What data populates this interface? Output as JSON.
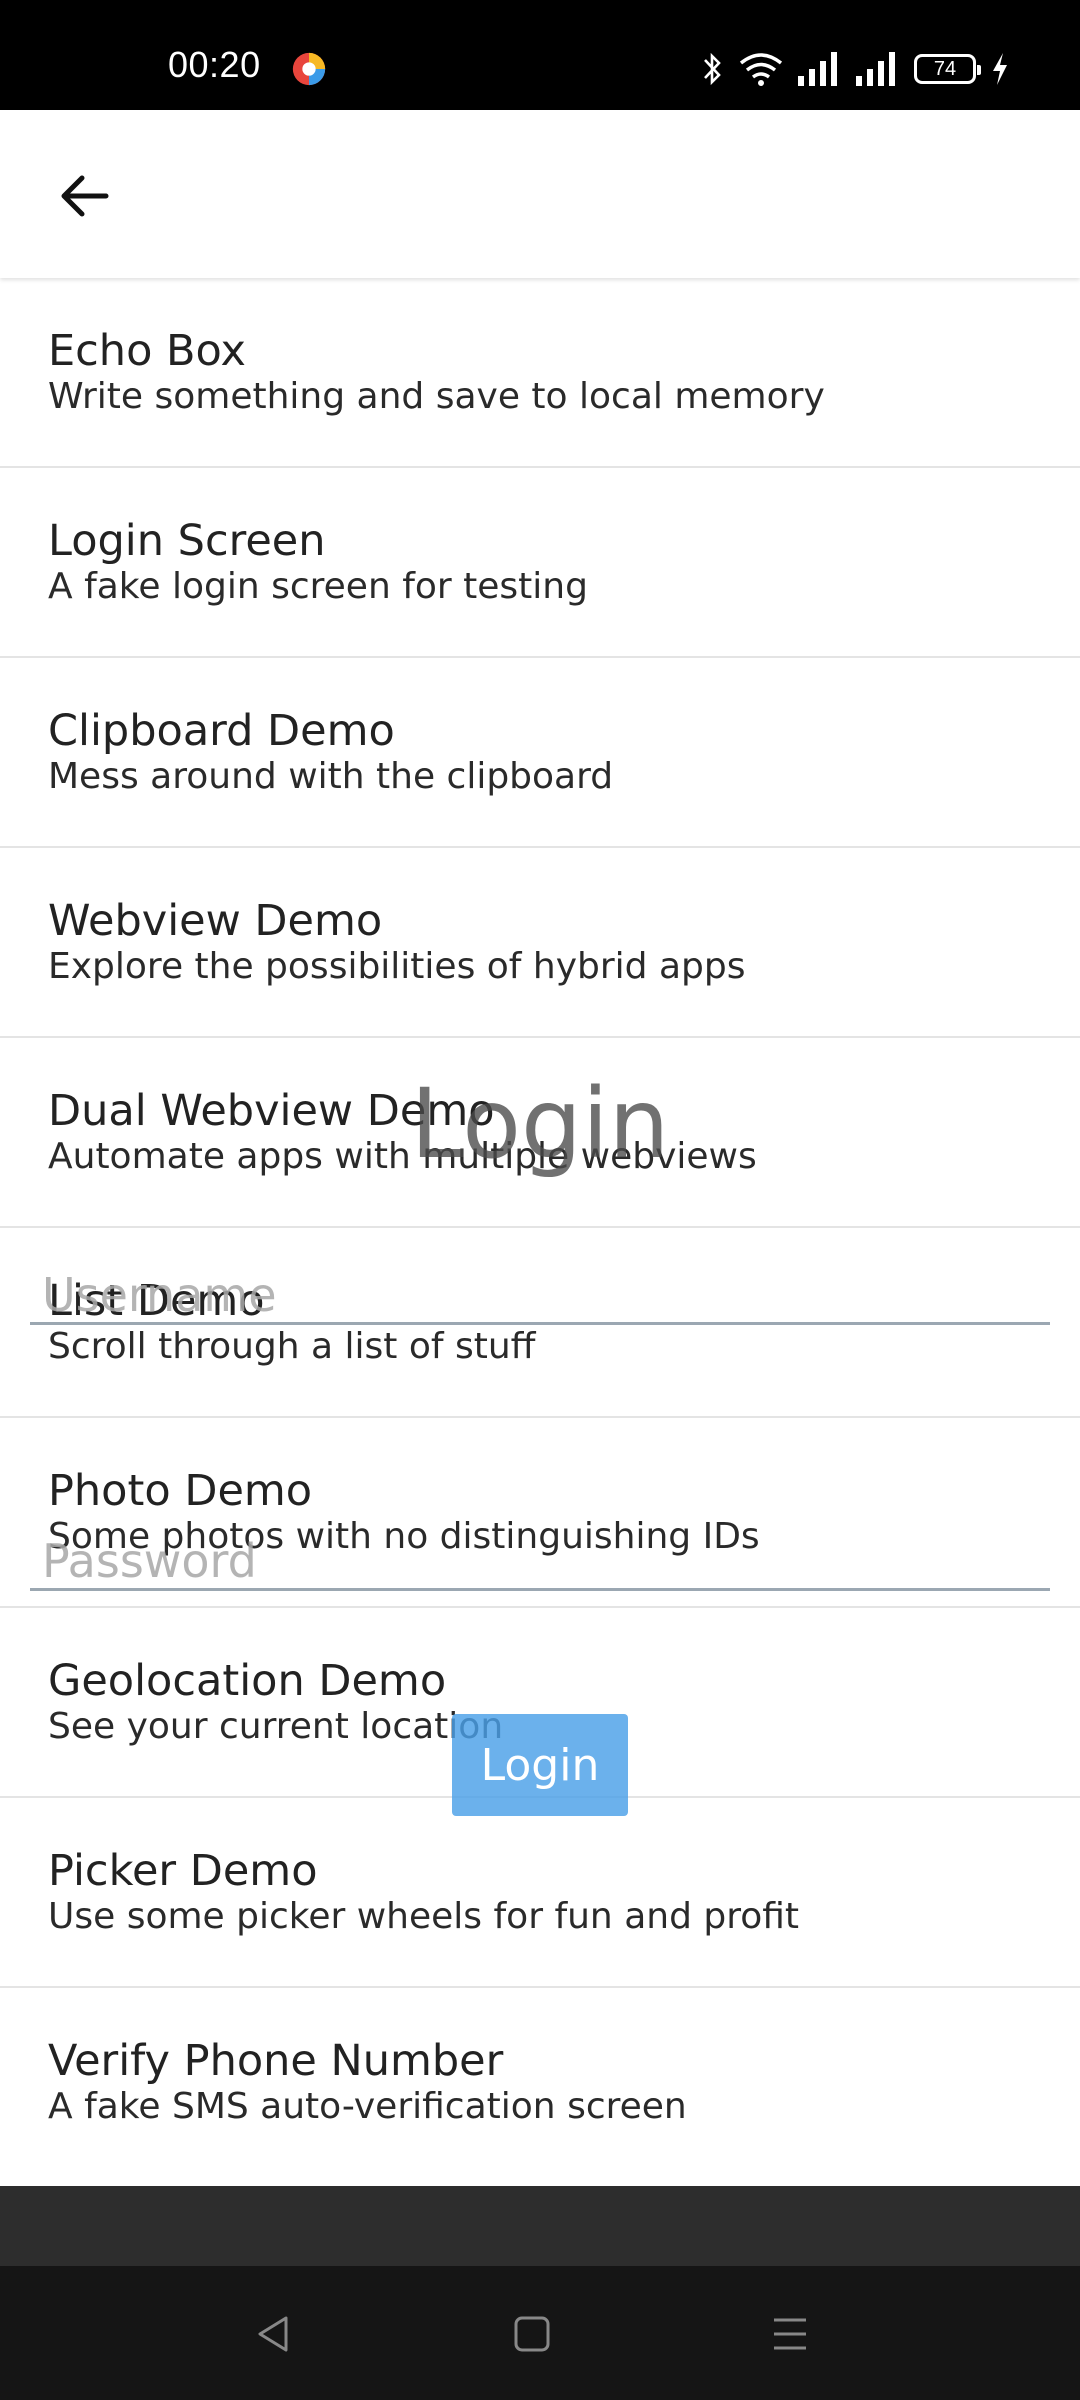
{
  "status_bar": {
    "time": "00:20",
    "battery": "74"
  },
  "menu": {
    "items": [
      {
        "title": "Echo Box",
        "subtitle": "Write something and save to local memory"
      },
      {
        "title": "Login Screen",
        "subtitle": "A fake login screen for testing"
      },
      {
        "title": "Clipboard Demo",
        "subtitle": "Mess around with the clipboard"
      },
      {
        "title": "Webview Demo",
        "subtitle": "Explore the possibilities of hybrid apps"
      },
      {
        "title": "Dual Webview Demo",
        "subtitle": "Automate apps with multiple webviews"
      },
      {
        "title": "List Demo",
        "subtitle": "Scroll through a list of stuff"
      },
      {
        "title": "Photo Demo",
        "subtitle": "Some photos with no distinguishing IDs"
      },
      {
        "title": "Geolocation Demo",
        "subtitle": "See your current location"
      },
      {
        "title": "Picker Demo",
        "subtitle": "Use some picker wheels for fun and profit"
      },
      {
        "title": "Verify Phone Number",
        "subtitle": "A fake SMS auto-verification screen"
      }
    ]
  },
  "login_overlay": {
    "heading": "Login",
    "username_placeholder": "Username",
    "password_placeholder": "Password",
    "button_label": "Login"
  },
  "icons": {
    "back": "arrow-left-icon",
    "nav_back": "triangle-back-icon",
    "nav_home": "square-home-icon",
    "nav_menu": "menu-lines-icon"
  },
  "colors": {
    "login_button": "#4AA0E8",
    "status_bar": "#000000",
    "nav_bar": "#151515"
  }
}
